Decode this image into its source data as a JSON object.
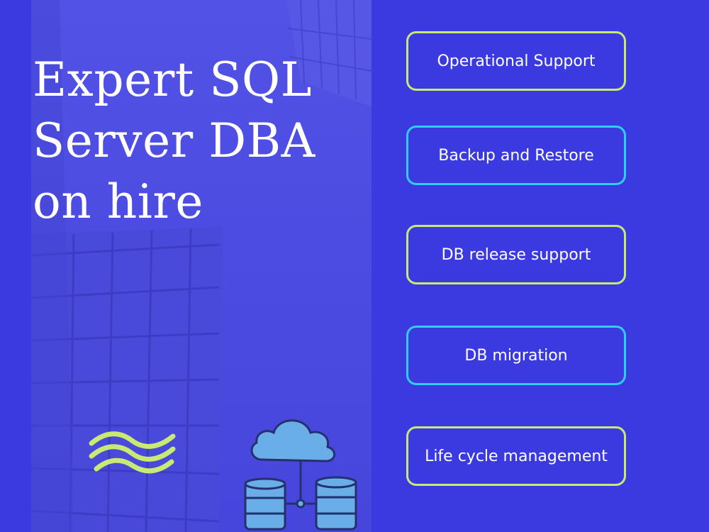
{
  "headline": {
    "lines": [
      "Expert SQL",
      "Server DBA",
      "on hire"
    ]
  },
  "services": [
    {
      "label": "Operational Support",
      "border_color": "#c8ea73"
    },
    {
      "label": "Backup and Restore",
      "border_color": "#31cdf2"
    },
    {
      "label": "DB release support",
      "border_color": "#c8ea73"
    },
    {
      "label": "DB migration",
      "border_color": "#31cdf2"
    },
    {
      "label": "Life cycle management",
      "border_color": "#c8ea73"
    }
  ],
  "icons": {
    "logo": "wave-logo-icon",
    "illustration": "cloud-database-icon"
  },
  "colors": {
    "background": "#3a3ae0",
    "accent_lime": "#c8ea73",
    "accent_cyan": "#31cdf2",
    "illustration_blue": "#6aaee8"
  }
}
